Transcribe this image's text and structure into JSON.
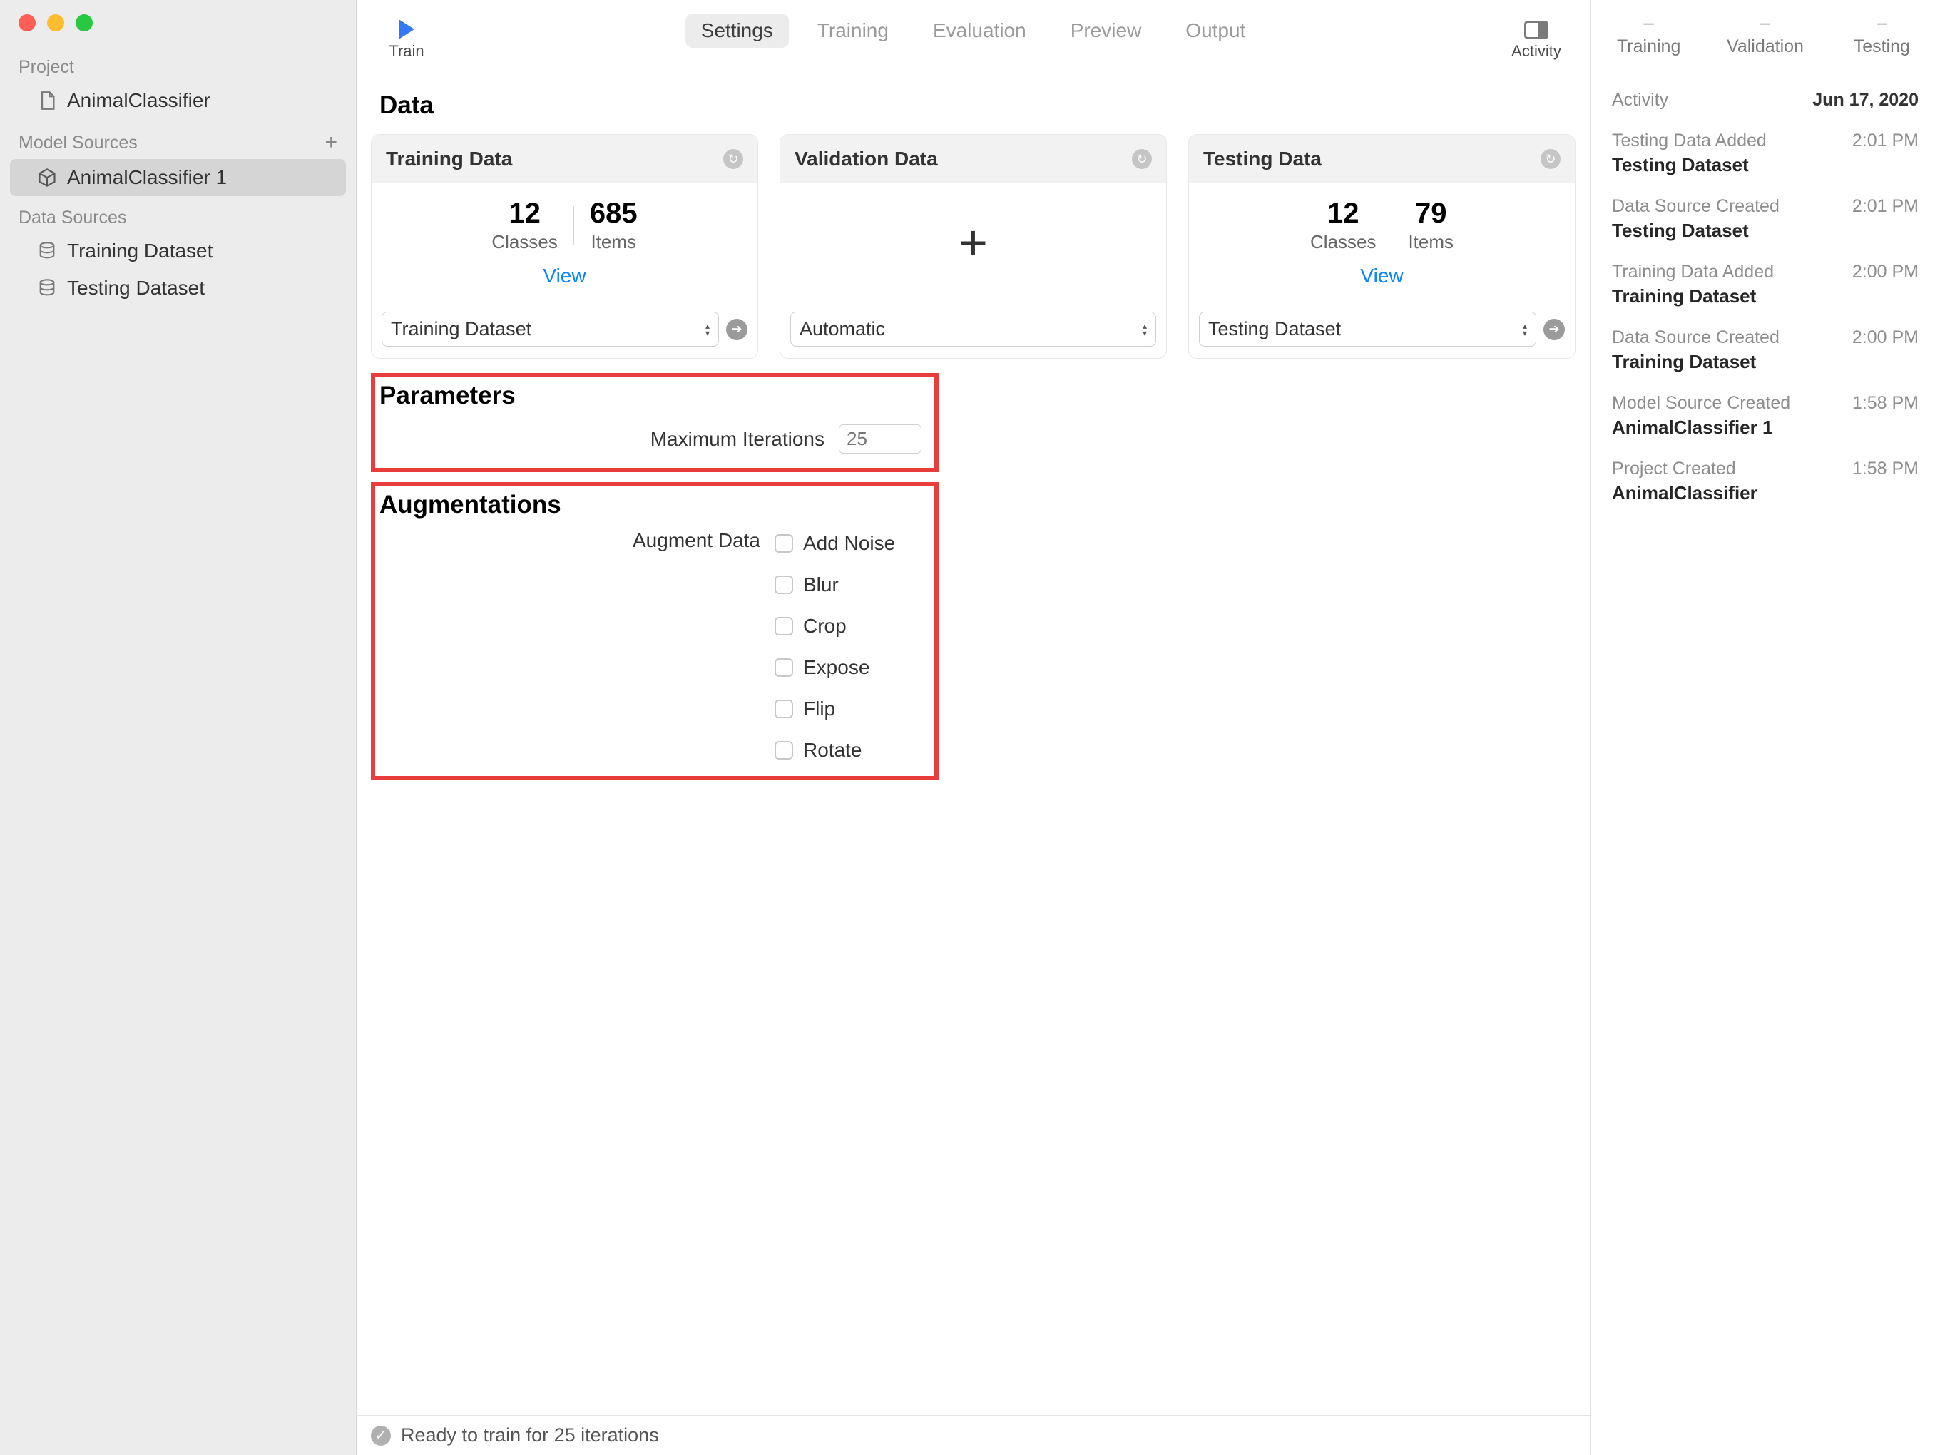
{
  "sidebar": {
    "projectLabel": "Project",
    "projectName": "AnimalClassifier",
    "modelSourcesLabel": "Model Sources",
    "modelSource": "AnimalClassifier 1",
    "dataSourcesLabel": "Data Sources",
    "dataSources": [
      "Training Dataset",
      "Testing Dataset"
    ]
  },
  "toolbar": {
    "train": "Train",
    "tabs": [
      "Settings",
      "Training",
      "Evaluation",
      "Preview",
      "Output"
    ],
    "activity": "Activity"
  },
  "sections": {
    "data": "Data",
    "parameters": "Parameters",
    "augmentations": "Augmentations"
  },
  "cards": {
    "training": {
      "title": "Training Data",
      "classes": "12",
      "classesLabel": "Classes",
      "items": "685",
      "itemsLabel": "Items",
      "view": "View",
      "select": "Training Dataset"
    },
    "validation": {
      "title": "Validation Data",
      "select": "Automatic"
    },
    "testing": {
      "title": "Testing Data",
      "classes": "12",
      "classesLabel": "Classes",
      "items": "79",
      "itemsLabel": "Items",
      "view": "View",
      "select": "Testing Dataset"
    }
  },
  "params": {
    "maxIterLabel": "Maximum Iterations",
    "maxIterValue": "25"
  },
  "augment": {
    "label": "Augment Data",
    "options": [
      "Add Noise",
      "Blur",
      "Crop",
      "Expose",
      "Flip",
      "Rotate"
    ]
  },
  "status": "Ready to train for 25 iterations",
  "metrics": {
    "training": "Training",
    "validation": "Validation",
    "testing": "Testing",
    "dash": "–"
  },
  "activity": {
    "label": "Activity",
    "date": "Jun 17, 2020",
    "items": [
      {
        "title": "Testing Data Added",
        "time": "2:01 PM",
        "detail": "Testing Dataset"
      },
      {
        "title": "Data Source Created",
        "time": "2:01 PM",
        "detail": "Testing Dataset"
      },
      {
        "title": "Training Data Added",
        "time": "2:00 PM",
        "detail": "Training Dataset"
      },
      {
        "title": "Data Source Created",
        "time": "2:00 PM",
        "detail": "Training Dataset"
      },
      {
        "title": "Model Source Created",
        "time": "1:58 PM",
        "detail": "AnimalClassifier 1"
      },
      {
        "title": "Project Created",
        "time": "1:58 PM",
        "detail": "AnimalClassifier"
      }
    ]
  }
}
